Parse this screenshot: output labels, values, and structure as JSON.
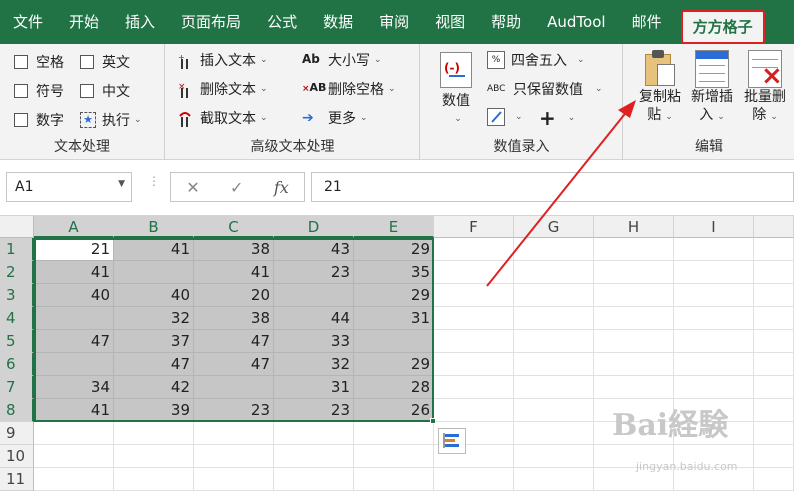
{
  "tabs": [
    "文件",
    "开始",
    "插入",
    "页面布局",
    "公式",
    "数据",
    "审阅",
    "视图",
    "帮助",
    "AudTool",
    "邮件"
  ],
  "active_tab": "方方格子",
  "groups": {
    "text": {
      "label": "文本处理",
      "col1": [
        "空格",
        "符号",
        "数字"
      ],
      "col2": [
        "英文",
        "中文"
      ],
      "execute": "执行"
    },
    "advanced": {
      "label": "高级文本处理",
      "col1": [
        "插入文本",
        "删除文本",
        "截取文本"
      ],
      "col2": [
        "大小写",
        "删除空格",
        "更多"
      ]
    },
    "numeric": {
      "label": "数值录入",
      "big": "数值",
      "round": "四舍五入",
      "keep": "只保留数值",
      "plus": "+"
    },
    "edit": {
      "label": "编辑",
      "copy_paste": [
        "复制粘",
        "贴"
      ],
      "new_insert": [
        "新增插",
        "入"
      ],
      "batch_delete": [
        "批量删",
        "除"
      ]
    }
  },
  "formula_bar": {
    "name_box": "A1",
    "fx": "fx",
    "value": "21"
  },
  "columns": [
    "A",
    "B",
    "C",
    "D",
    "E",
    "F",
    "G",
    "H",
    "I"
  ],
  "rows": [
    "1",
    "2",
    "3",
    "4",
    "5",
    "6",
    "7",
    "8",
    "9",
    "10",
    "11"
  ],
  "cells": [
    [
      "21",
      "41",
      "38",
      "43",
      "29"
    ],
    [
      "41",
      "",
      "41",
      "23",
      "35"
    ],
    [
      "40",
      "40",
      "20",
      "",
      "29"
    ],
    [
      "",
      "32",
      "38",
      "44",
      "31"
    ],
    [
      "47",
      "37",
      "47",
      "33",
      ""
    ],
    [
      "",
      "47",
      "47",
      "32",
      "29"
    ],
    [
      "34",
      "42",
      "",
      "31",
      "28"
    ],
    [
      "41",
      "39",
      "23",
      "23",
      "26"
    ]
  ],
  "watermark": {
    "main": "Bai経験",
    "sub": "jingyan.baidu.com"
  },
  "colors": {
    "excel_green": "#217346",
    "highlight_red": "#e02020"
  }
}
